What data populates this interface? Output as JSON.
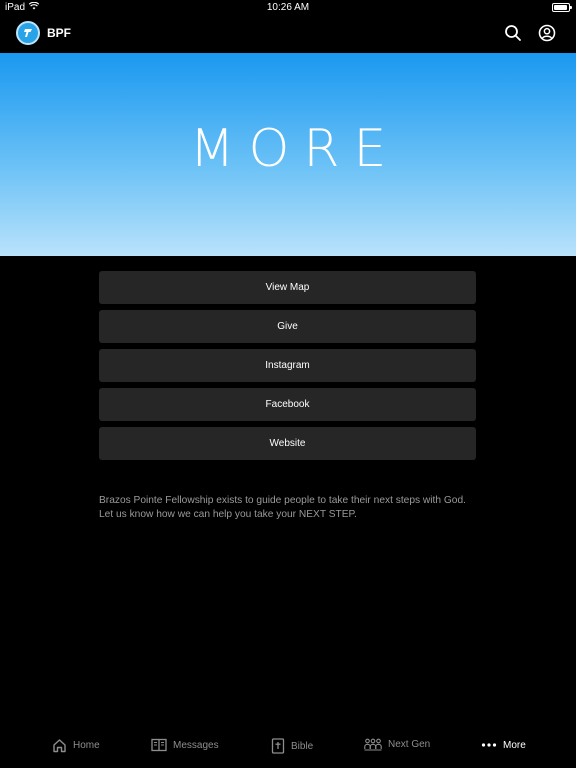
{
  "status_bar": {
    "device": "iPad",
    "time": "10:26 AM",
    "battery_level": 0.9
  },
  "header": {
    "app_name": "BPF",
    "logo_icon": "bpf-logo-icon",
    "actions": [
      "search-icon",
      "account-icon"
    ]
  },
  "hero": {
    "title": "MORE"
  },
  "menu": {
    "items": [
      "View Map",
      "Give",
      "Instagram",
      "Facebook",
      "Website"
    ]
  },
  "about": {
    "text": "Brazos Pointe Fellowship exists to guide people to take their next steps with God. Let us know how we can help you take your NEXT STEP."
  },
  "tab_bar": {
    "items": [
      {
        "label": "Home",
        "icon": "home-icon",
        "active": false
      },
      {
        "label": "Messages",
        "icon": "book-open-icon",
        "active": false
      },
      {
        "label": "Bible",
        "icon": "bible-icon",
        "active": false
      },
      {
        "label": "Next Gen",
        "icon": "people-icon",
        "active": false
      },
      {
        "label": "More",
        "icon": "more-dots-icon",
        "active": true
      }
    ]
  },
  "colors": {
    "accent": "#1a98f0",
    "background": "#000000",
    "button": "#262626",
    "inactive_tab": "#8e8e8e"
  }
}
